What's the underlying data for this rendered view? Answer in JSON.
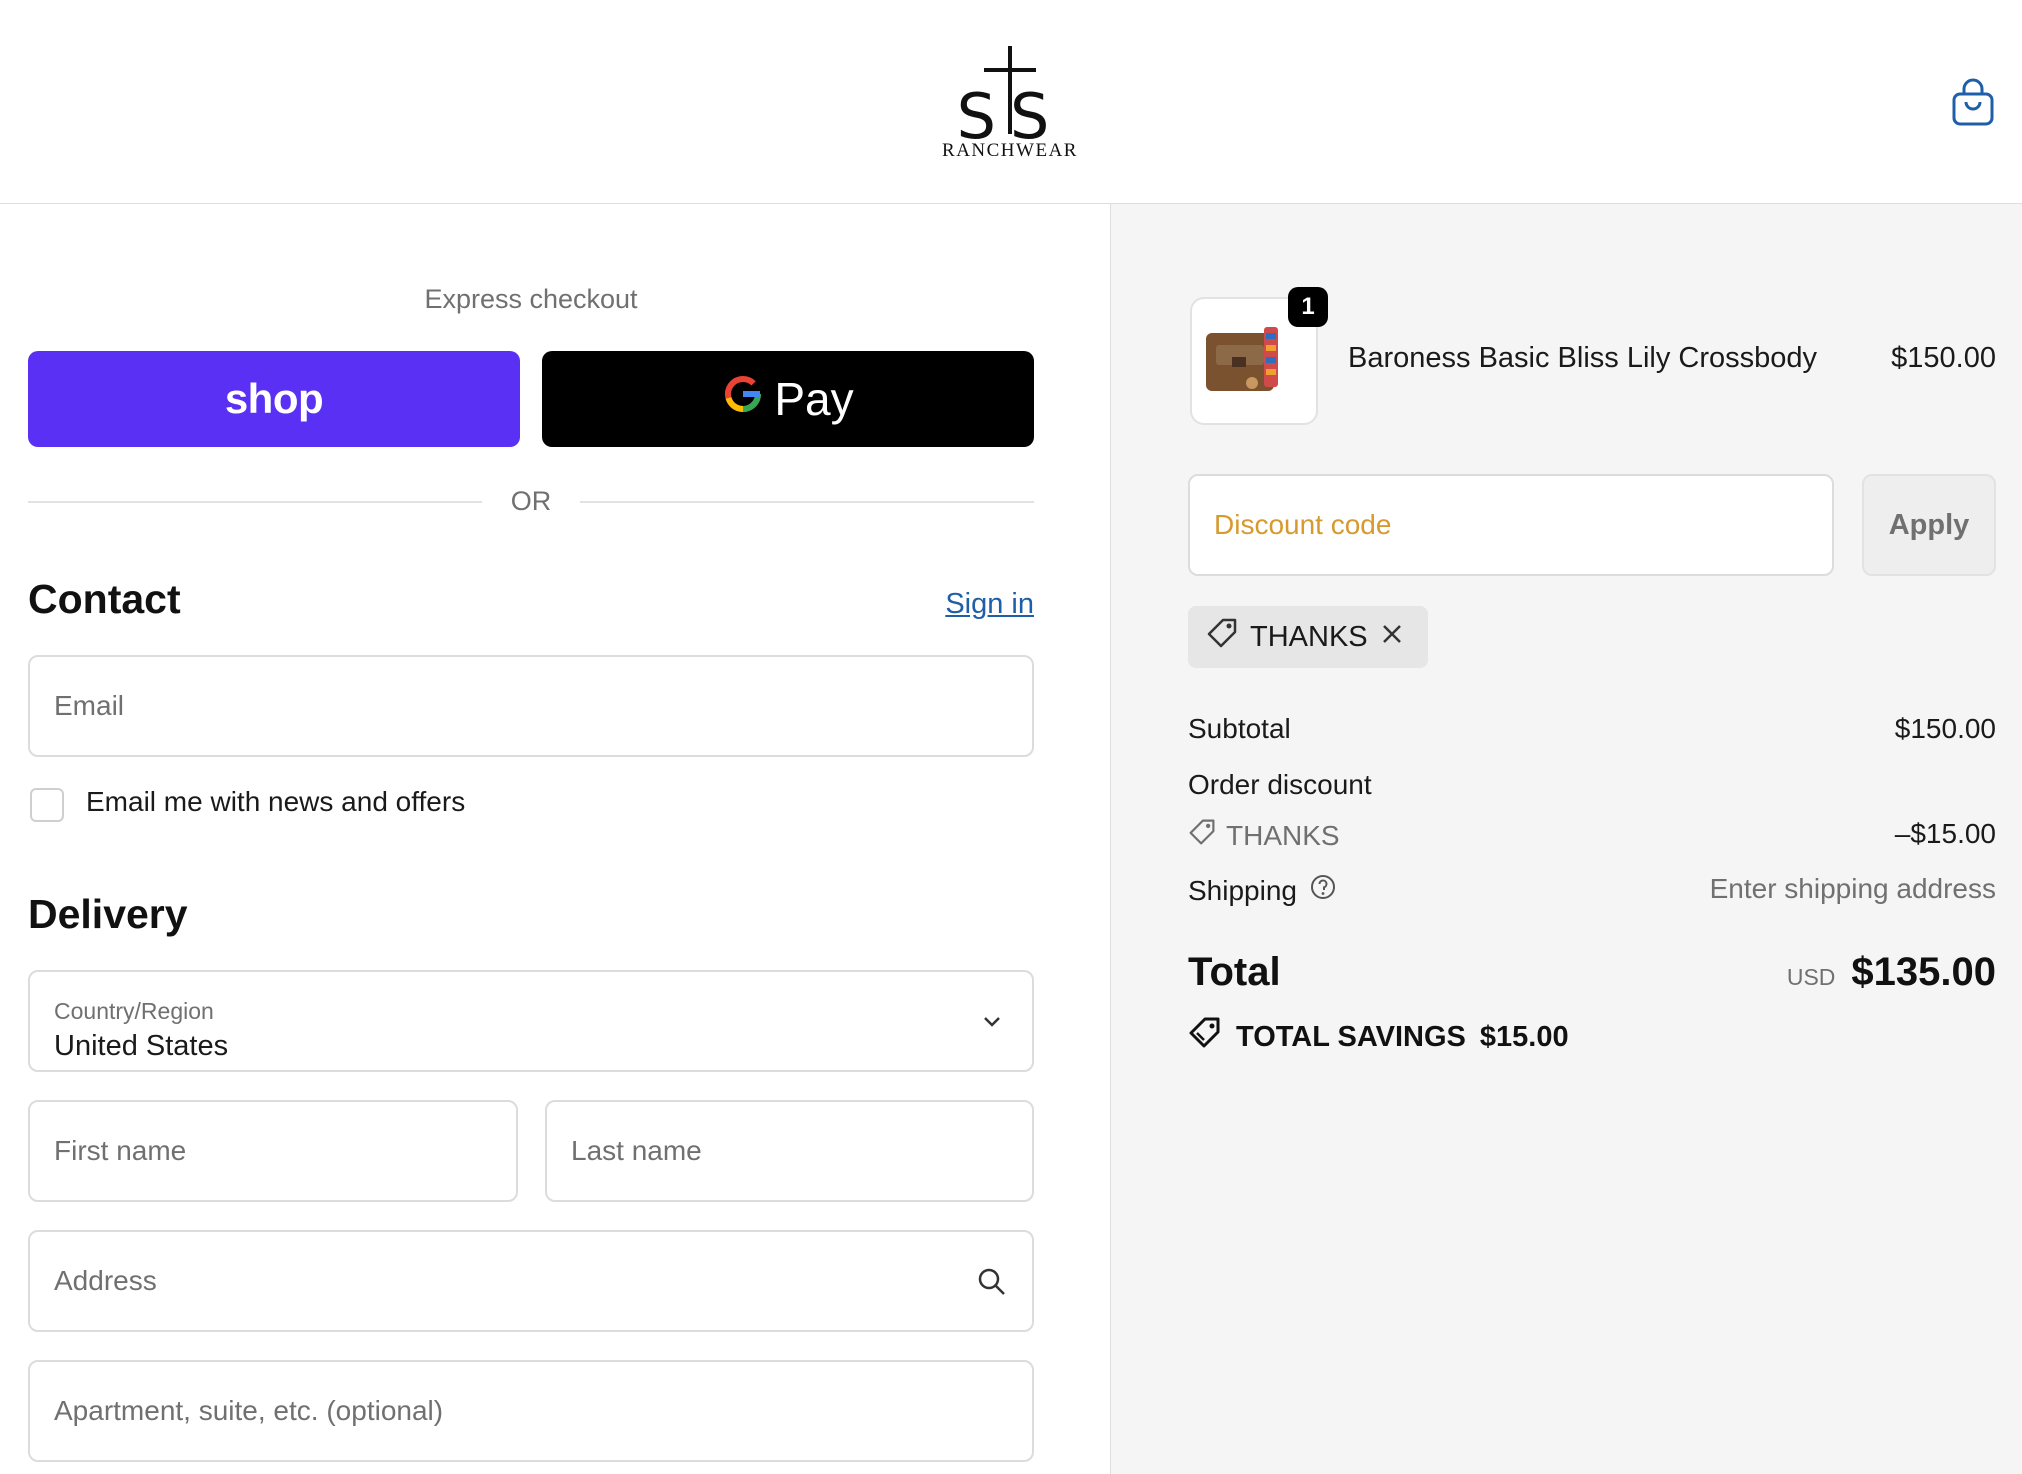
{
  "brand": {
    "logo_letters": "STS",
    "logo_text": "Ranchwear"
  },
  "header": {
    "cart_icon": "shopping-bag-icon"
  },
  "express": {
    "title": "Express checkout",
    "shop_label": "shop",
    "gpay_label": "Pay",
    "or_label": "OR"
  },
  "contact": {
    "title": "Contact",
    "sign_in": "Sign in",
    "email_placeholder": "Email",
    "newsletter_label": "Email me with news and offers"
  },
  "delivery": {
    "title": "Delivery",
    "country_label": "Country/Region",
    "country_value": "United States",
    "first_name_placeholder": "First name",
    "last_name_placeholder": "Last name",
    "address_placeholder": "Address",
    "apartment_placeholder": "Apartment, suite, etc. (optional)"
  },
  "summary": {
    "item": {
      "quantity": "1",
      "name": "Baroness Basic Bliss Lily Crossbody",
      "price": "$150.00"
    },
    "discount_placeholder": "Discount code",
    "apply_label": "Apply",
    "applied_code": "THANKS",
    "subtotal_label": "Subtotal",
    "subtotal_value": "$150.00",
    "order_discount_label": "Order discount",
    "discount_code_label": "THANKS",
    "discount_value": "–$15.00",
    "shipping_label": "Shipping",
    "shipping_value": "Enter shipping address",
    "total_label": "Total",
    "currency": "USD",
    "total_value": "$135.00",
    "savings_label": "TOTAL SAVINGS",
    "savings_value": "$15.00"
  },
  "colors": {
    "shop_purple": "#5a31f4",
    "link_blue": "#1f5fa8",
    "discount_placeholder": "#d69a2e"
  }
}
